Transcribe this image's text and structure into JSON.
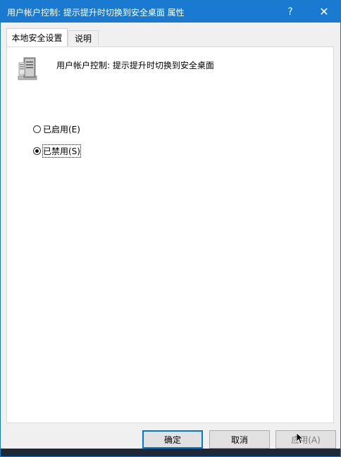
{
  "window": {
    "title": "用户帐户控制: 提示提升时切换到安全桌面 属性",
    "help_glyph": "?",
    "close_glyph": "✕"
  },
  "tabs": [
    {
      "label": "本地安全设置",
      "active": true
    },
    {
      "label": "说明",
      "active": false
    }
  ],
  "policy": {
    "icon": "server-policy-icon",
    "name": "用户帐户控制: 提示提升时切换到安全桌面"
  },
  "options": [
    {
      "label": "已启用(E)",
      "checked": false
    },
    {
      "label": "已禁用(S)",
      "checked": true
    }
  ],
  "buttons": {
    "ok": "确定",
    "cancel": "取消",
    "apply": "应用(A)"
  },
  "colors": {
    "titlebar": "#1a7ad2",
    "focus_border": "#0078d7"
  }
}
